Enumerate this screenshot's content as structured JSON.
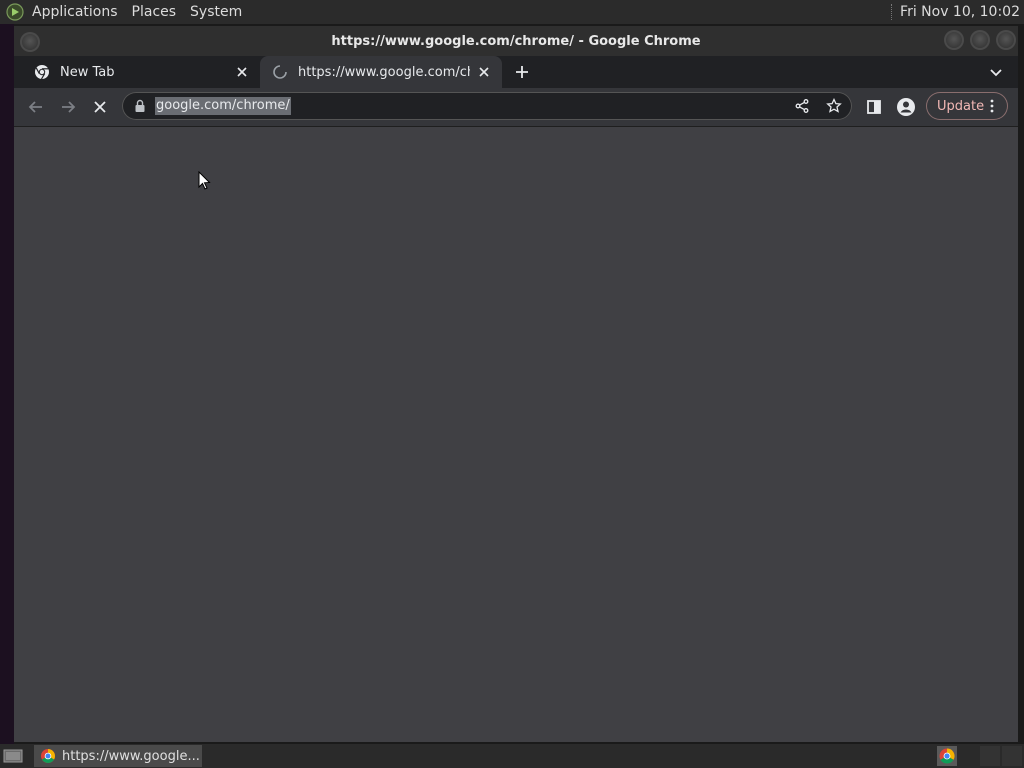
{
  "top_panel": {
    "menus": [
      "Applications",
      "Places",
      "System"
    ],
    "clock": "Fri Nov 10, 10:02"
  },
  "window": {
    "title": "https://www.google.com/chrome/ - Google Chrome"
  },
  "tabs": [
    {
      "title": "New Tab",
      "icon": "chrome-icon"
    },
    {
      "title": "https://www.google.com/chrome/",
      "icon": "loading-spinner-icon",
      "active": true
    }
  ],
  "toolbar": {
    "url": "google.com/chrome/",
    "update_label": "Update"
  },
  "taskbar": {
    "task_label": "https://www.google..."
  },
  "colors": {
    "chrome_frame": "#202124",
    "toolbar": "#35363a",
    "content": "#404044",
    "update_accent": "#f2b8b5"
  }
}
